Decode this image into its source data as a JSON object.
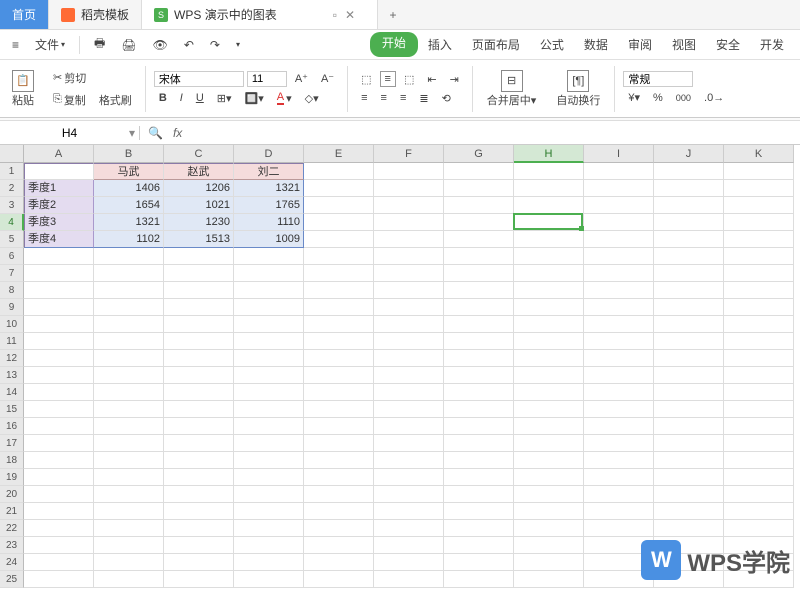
{
  "tabs": {
    "home": "首页",
    "template": "稻壳模板",
    "doc": "WPS 演示中的图表"
  },
  "menu": {
    "file": "文件",
    "tabs": [
      "开始",
      "插入",
      "页面布局",
      "公式",
      "数据",
      "审阅",
      "视图",
      "安全",
      "开发"
    ]
  },
  "ribbon": {
    "cut": "剪切",
    "paste": "粘贴",
    "copy": "复制",
    "format_painter": "格式刷",
    "font": "宋体",
    "font_size": "11",
    "merge": "合并居中",
    "wrap": "自动换行",
    "number_format": "常规"
  },
  "name_box": "H4",
  "columns": [
    "A",
    "B",
    "C",
    "D",
    "E",
    "F",
    "G",
    "H",
    "I",
    "J",
    "K"
  ],
  "row_count": 25,
  "active": {
    "col": 7,
    "row": 3
  },
  "chart_data": {
    "type": "table",
    "title": "",
    "col_headers": [
      "马武",
      "赵武",
      "刘二"
    ],
    "row_headers": [
      "季度1",
      "季度2",
      "季度3",
      "季度4"
    ],
    "data": [
      [
        1406,
        1206,
        1321
      ],
      [
        1654,
        1021,
        1765
      ],
      [
        1321,
        1230,
        1110
      ],
      [
        1102,
        1513,
        1009
      ]
    ]
  },
  "watermark": "WPS学院"
}
